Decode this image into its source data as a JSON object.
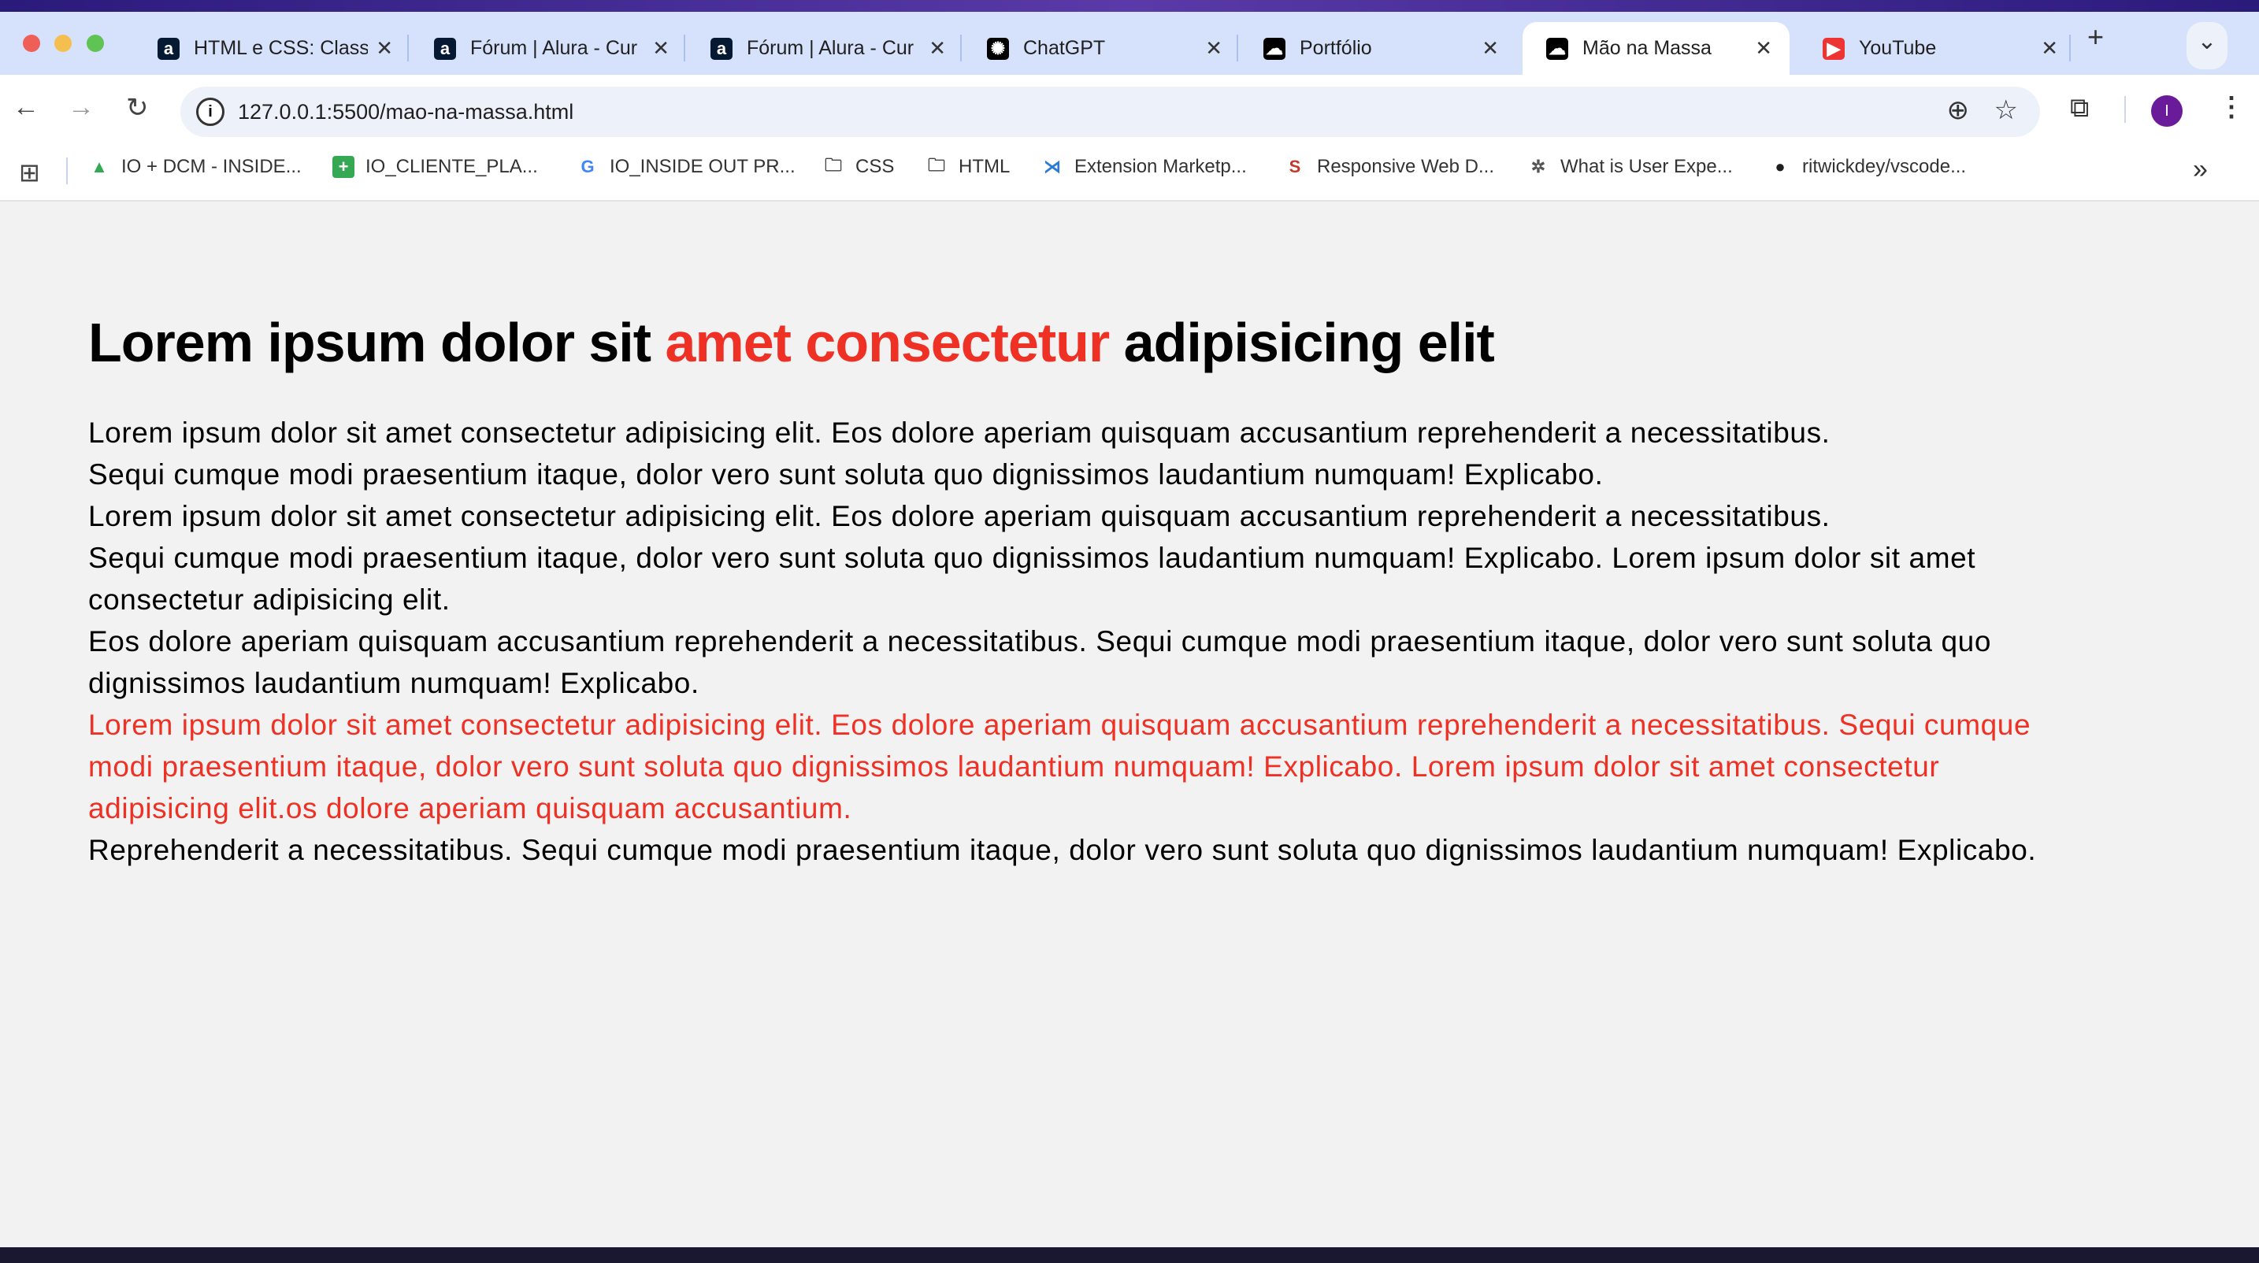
{
  "browser": {
    "tabs": [
      {
        "title": "HTML e CSS: Class",
        "icon": "alura-icon",
        "icon_char": "a",
        "icon_bg": "#051933"
      },
      {
        "title": "Fórum | Alura - Cur",
        "icon": "alura-icon",
        "icon_char": "a",
        "icon_bg": "#051933"
      },
      {
        "title": "Fórum | Alura - Cur",
        "icon": "alura-icon",
        "icon_char": "a",
        "icon_bg": "#051933"
      },
      {
        "title": "ChatGPT",
        "icon": "chatgpt-icon",
        "icon_char": "✺",
        "icon_bg": "#000000"
      },
      {
        "title": "Portfólio",
        "icon": "cloud-icon",
        "icon_char": "☁",
        "icon_bg": "#000000"
      },
      {
        "title": "Mão na Massa",
        "icon": "cloud-icon",
        "icon_char": "☁",
        "icon_bg": "#000000",
        "active": true
      },
      {
        "title": "YouTube",
        "icon": "youtube-icon",
        "icon_char": "▶",
        "icon_bg": "#ee3333"
      }
    ],
    "close_glyph": "✕",
    "new_tab_glyph": "+",
    "tab_search_glyph": "⌄",
    "url": "127.0.0.1:5500/mao-na-massa.html",
    "avatar_initial": "I",
    "avatar_color": "#6a1b9a",
    "bookmarks": [
      {
        "label": "IO + DCM - INSIDE...",
        "icon": "google-drive-icon",
        "glyph": "▲",
        "color": "#34a853"
      },
      {
        "label": "IO_CLIENTE_PLA...",
        "icon": "google-sheets-icon",
        "glyph": "+",
        "color": "#ffffff",
        "bg": "#34a853"
      },
      {
        "label": "IO_INSIDE OUT PR...",
        "icon": "google-icon",
        "glyph": "G",
        "color": "#4285f4"
      },
      {
        "label": "CSS",
        "icon": "folder-icon",
        "glyph": "🗀",
        "color": "#444444"
      },
      {
        "label": "HTML",
        "icon": "folder-icon",
        "glyph": "🗀",
        "color": "#444444"
      },
      {
        "label": "Extension Marketp...",
        "icon": "vscode-icon",
        "glyph": "⋊",
        "color": "#2a7bd4"
      },
      {
        "label": "Responsive Web D...",
        "icon": "scribd-icon",
        "glyph": "S",
        "color": "#c0392b"
      },
      {
        "label": "What is User Expe...",
        "icon": "tree-icon",
        "glyph": "✲",
        "color": "#555555"
      },
      {
        "label": "ritwickdey/vscode...",
        "icon": "github-icon",
        "glyph": "●",
        "color": "#1f1f1f"
      }
    ],
    "bookmarks_overflow_glyph": "»"
  },
  "page": {
    "heading": {
      "part1": "Lorem ipsum dolor sit ",
      "accent": "amet consectetur",
      "part2": " adipisicing elit"
    },
    "accent_color": "#ee3124",
    "lines": [
      {
        "text": "Lorem ipsum dolor sit amet consectetur adipisicing elit. Eos dolore aperiam quisquam accusantium reprehenderit a necessitatibus.",
        "red": false
      },
      {
        "text": "Sequi cumque modi praesentium itaque, dolor vero sunt soluta quo dignissimos laudantium numquam! Explicabo.",
        "red": false
      },
      {
        "text": "Lorem ipsum dolor sit amet consectetur adipisicing elit. Eos dolore aperiam quisquam accusantium reprehenderit a necessitatibus.",
        "red": false
      },
      {
        "text": "Sequi cumque modi praesentium itaque, dolor vero sunt soluta quo dignissimos laudantium numquam! Explicabo. Lorem ipsum dolor sit amet",
        "red": false
      },
      {
        "text": "consectetur adipisicing elit.",
        "red": false
      },
      {
        "text": "Eos dolore aperiam quisquam accusantium reprehenderit a necessitatibus. Sequi cumque modi praesentium itaque, dolor vero sunt soluta quo",
        "red": false
      },
      {
        "text": "dignissimos laudantium numquam! Explicabo.",
        "red": false
      },
      {
        "text": "Lorem ipsum dolor sit amet consectetur adipisicing elit. Eos dolore aperiam quisquam accusantium reprehenderit a necessitatibus. Sequi cumque",
        "red": true
      },
      {
        "text": "modi praesentium itaque, dolor vero sunt soluta quo dignissimos laudantium numquam! Explicabo. Lorem ipsum dolor sit amet consectetur",
        "red": true
      },
      {
        "text": "adipisicing elit.os dolore aperiam quisquam accusantium.",
        "red": true
      },
      {
        "text": "Reprehenderit a necessitatibus. Sequi cumque modi praesentium itaque, dolor vero sunt soluta quo dignissimos laudantium numquam! Explicabo.",
        "red": false
      }
    ]
  }
}
